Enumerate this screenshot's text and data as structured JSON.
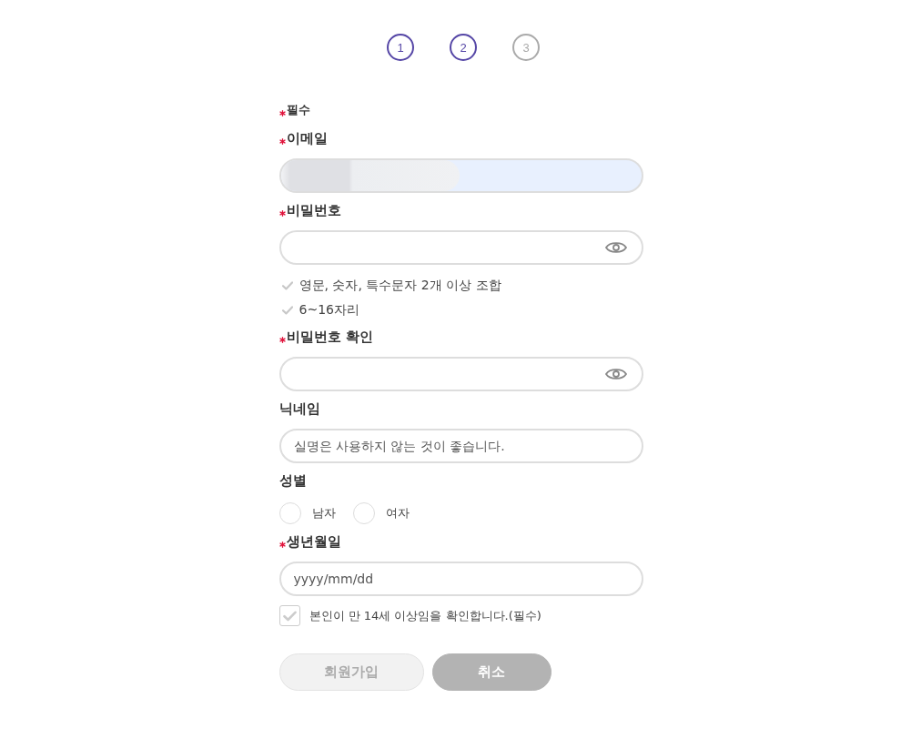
{
  "steps": [
    {
      "label": "1",
      "active": true
    },
    {
      "label": "2",
      "active": true
    },
    {
      "label": "3",
      "active": false
    }
  ],
  "required_note": {
    "label": "필수",
    "required": true
  },
  "fields": [
    {
      "kind": "text",
      "label": "이메일",
      "required": true,
      "autofilled": true,
      "redacted": true
    },
    {
      "kind": "password",
      "label": "비밀번호",
      "required": true,
      "rules": [
        {
          "text": "영문, 숫자, 특수문자 2개 이상 조합",
          "met": false
        },
        {
          "text": "6~16자리",
          "met": false
        }
      ]
    },
    {
      "kind": "password",
      "label": "비밀번호 확인",
      "required": true
    },
    {
      "kind": "text",
      "label": "닉네임",
      "required": false,
      "placeholder": "실명은 사용하지 않는 것이 좋습니다."
    },
    {
      "kind": "radio",
      "label": "성별",
      "required": false,
      "options": [
        {
          "label": "남자",
          "selected": false
        },
        {
          "label": "여자",
          "selected": false
        }
      ]
    },
    {
      "kind": "text",
      "label": "생년월일",
      "required": true,
      "placeholder": "yyyy/mm/dd"
    }
  ],
  "age_consent": {
    "text": "본인이 만 14세 이상임을 확인합니다.(필수)",
    "checked": false
  },
  "buttons": [
    {
      "label": "회원가입",
      "kind": "secondary"
    },
    {
      "label": "취소",
      "kind": "primary"
    }
  ]
}
